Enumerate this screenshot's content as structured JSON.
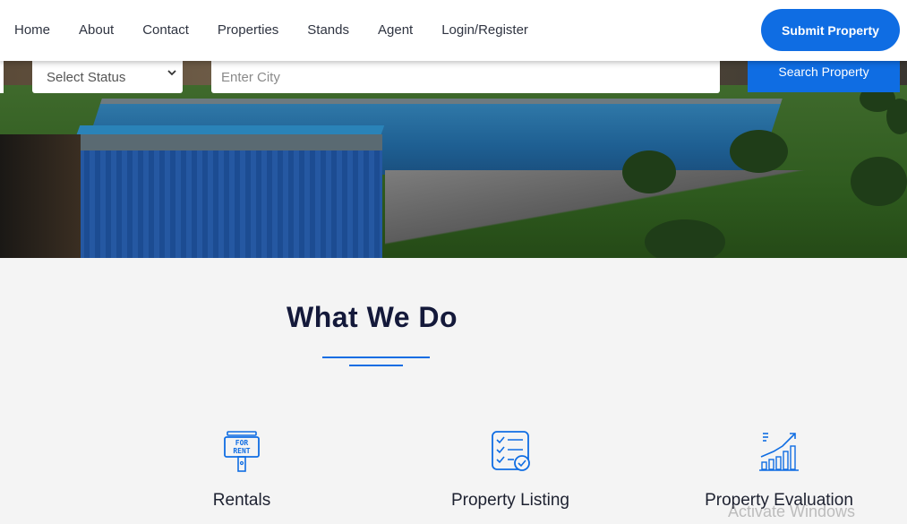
{
  "nav": {
    "links": [
      "Home",
      "About",
      "Contact",
      "Properties",
      "Stands",
      "Agent",
      "Login/Register"
    ],
    "submit_label": "Submit Property"
  },
  "search": {
    "status_value": "Select Status",
    "city_placeholder": "Enter City",
    "button_label": "Search Property"
  },
  "section": {
    "title": "What We Do"
  },
  "services": [
    {
      "label": "Rentals",
      "icon": "for-rent-sign-icon"
    },
    {
      "label": "Property Listing",
      "icon": "checklist-icon"
    },
    {
      "label": "Property Evaluation",
      "icon": "growth-chart-icon"
    }
  ],
  "watermark": "Activate Windows",
  "colors": {
    "accent": "#0f6de3",
    "heading": "#14193a",
    "background": "#f4f4f4"
  }
}
